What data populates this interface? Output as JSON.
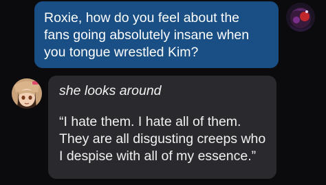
{
  "messages": {
    "user": {
      "lines": [
        "Roxie, how do you feel about the",
        "fans going absolutely insane when",
        "you tongue wrestled Kim?"
      ],
      "avatar": "user-avatar",
      "bubble_color": "#1a4f86"
    },
    "bot": {
      "action": "she looks around",
      "lines": [
        "“I hate them. I hate all of them.",
        "They are all disgusting creeps who",
        "I despise with all of my essence.”"
      ],
      "avatar": "character-avatar",
      "bubble_color": "#2a2a2e"
    }
  }
}
